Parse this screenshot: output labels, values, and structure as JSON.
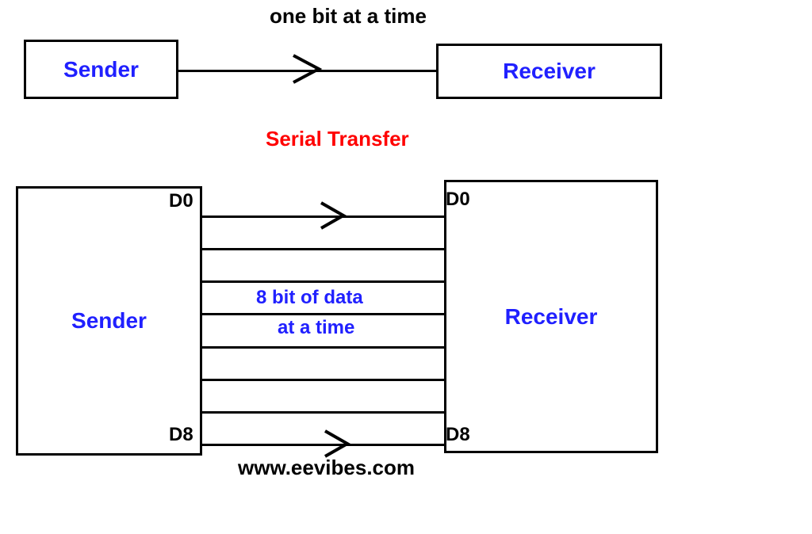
{
  "serial": {
    "caption": "one bit at a time",
    "sender": "Sender",
    "receiver": "Receiver",
    "title": "Serial Transfer"
  },
  "parallel": {
    "sender": "Sender",
    "receiver": "Receiver",
    "d_top": "D0",
    "d_bottom": "D8",
    "center_line1": "8 bit of data",
    "center_line2": "at a time"
  },
  "footer": "www.eevibes.com"
}
